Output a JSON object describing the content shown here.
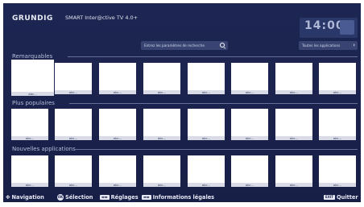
{
  "header": {
    "brand": "GRUNDIG",
    "product": "SMART Inter@ctive TV 4.0+",
    "clock": "14:00"
  },
  "search": {
    "placeholder": "Entrez les paramètres de recherche"
  },
  "all_apps": {
    "label": "Toutes les applications"
  },
  "sections": [
    {
      "title": "Remarquables",
      "tiles": [
        "abc...",
        "abc...",
        "abc...",
        "abc...",
        "abc...",
        "abc...",
        "abc...",
        "abc..."
      ]
    },
    {
      "title": "Plus populaires",
      "tiles": [
        "abc...",
        "abc...",
        "abc...",
        "abc...",
        "abc...",
        "abc...",
        "abc...",
        "abc..."
      ]
    },
    {
      "title": "Nouvelles applications",
      "tiles": [
        "abc...",
        "abc...",
        "abc...",
        "abc...",
        "abc...",
        "abc...",
        "abc...",
        "abc..."
      ]
    }
  ],
  "footer": {
    "navigation": "Navigation",
    "ok_key": "OK",
    "selection": "Sélection",
    "settings_key": "▬▬",
    "settings": "Réglages",
    "info_key": "▬▬",
    "info": "Informations légales",
    "exit_key": "EXIT",
    "quit": "Quitter"
  }
}
